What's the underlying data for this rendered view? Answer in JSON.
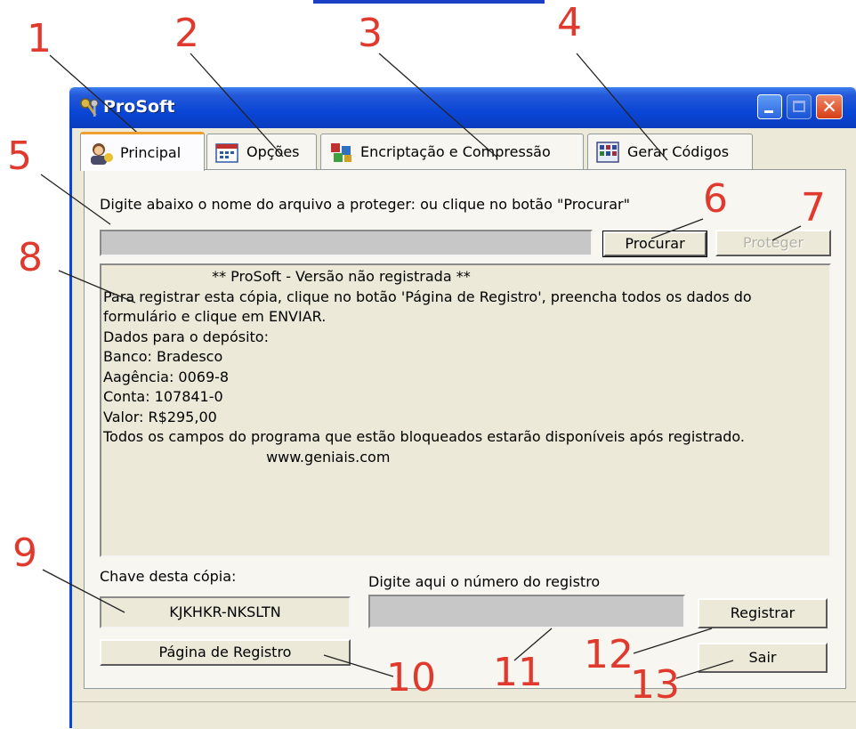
{
  "window": {
    "title": "ProSoft"
  },
  "tabs": [
    {
      "label": "Principal",
      "icon": "person-icon"
    },
    {
      "label": "Opções",
      "icon": "calendar-icon"
    },
    {
      "label": "Encriptação e Compressão",
      "icon": "boxes-icon"
    },
    {
      "label": "Gerar Códigos",
      "icon": "grid-icon"
    }
  ],
  "main": {
    "file_prompt": "Digite abaixo o nome do arquivo a proteger: ou clique no botão \"Procurar\"",
    "file_value": "",
    "browse_label": "Procurar",
    "protect_label": "Proteger",
    "info_lines": [
      "                        ** ProSoft - Versão não registrada **",
      "",
      "Para registrar esta cópia, clique no botão 'Página de Registro', preencha todos os dados do",
      "formulário e clique em ENVIAR.",
      "Dados para o depósito:",
      "Banco: Bradesco",
      "Aagência: 0069-8",
      "Conta: 107841-0",
      "Valor: R$295,00",
      "Todos os campos do programa que estão bloqueados estarão disponíveis após registrado.",
      "",
      "                                    www.geniais.com"
    ],
    "key_label": "Chave desta cópia:",
    "key_value": "KJKHKR-NKSLTN",
    "register_prompt": "Digite aqui o número do registro",
    "register_value": "",
    "register_page_label": "Página de Registro",
    "register_label": "Registrar",
    "exit_label": "Sair"
  },
  "annotations": [
    "1",
    "2",
    "3",
    "4",
    "5",
    "6",
    "7",
    "8",
    "9",
    "10",
    "11",
    "12",
    "13"
  ],
  "colors": {
    "annotation": "#e03a2e",
    "titlebar": "#0a46d6",
    "window_bg": "#ece9d8"
  }
}
